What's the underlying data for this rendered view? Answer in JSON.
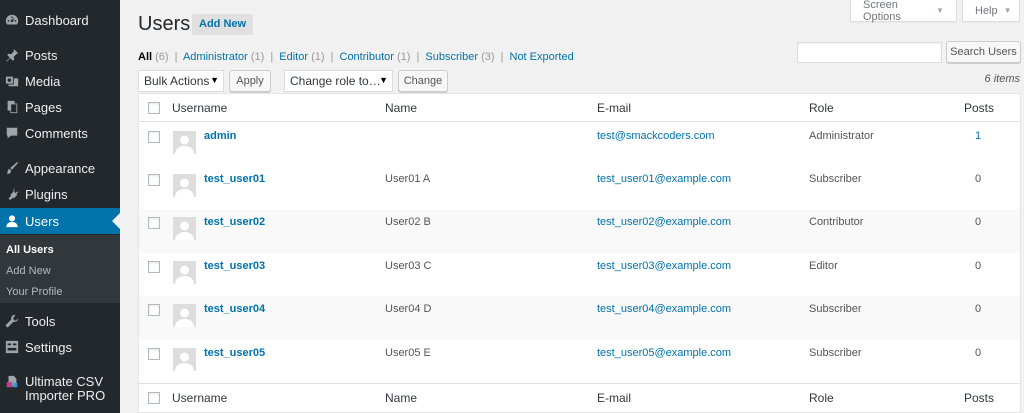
{
  "sidebar": {
    "items": [
      {
        "label": "Dashboard",
        "icon": "dashboard-icon"
      },
      {
        "label": "Posts",
        "icon": "pin-icon"
      },
      {
        "label": "Media",
        "icon": "media-icon"
      },
      {
        "label": "Pages",
        "icon": "pages-icon"
      },
      {
        "label": "Comments",
        "icon": "comment-icon"
      },
      {
        "label": "Appearance",
        "icon": "brush-icon"
      },
      {
        "label": "Plugins",
        "icon": "plug-icon"
      },
      {
        "label": "Users",
        "icon": "user-icon",
        "active": true
      },
      {
        "label": "Tools",
        "icon": "wrench-icon"
      },
      {
        "label": "Settings",
        "icon": "settings-icon"
      },
      {
        "label": "Ultimate CSV Importer PRO",
        "icon": "csv-importer-icon"
      }
    ],
    "users_submenu": [
      "All Users",
      "Add New",
      "Your Profile"
    ]
  },
  "header": {
    "title": "Users",
    "add_new": "Add New",
    "screen_options": "Screen Options",
    "help": "Help"
  },
  "filters": {
    "all": "All",
    "all_count": "(6)",
    "administrator": "Administrator",
    "administrator_count": "(1)",
    "editor": "Editor",
    "editor_count": "(1)",
    "contributor": "Contributor",
    "contributor_count": "(1)",
    "subscriber": "Subscriber",
    "subscriber_count": "(3)",
    "not_exported": "Not Exported",
    "separator": "|"
  },
  "search": {
    "value": "",
    "button": "Search Users"
  },
  "toolbar": {
    "bulk_actions": "Bulk Actions",
    "apply": "Apply",
    "change_role": "Change role to…",
    "change": "Change",
    "items_count": "6 items"
  },
  "table": {
    "columns": [
      "Username",
      "Name",
      "E-mail",
      "Role",
      "Posts"
    ],
    "rows": [
      {
        "username": "admin",
        "name": "",
        "email": "test@smackcoders.com",
        "role": "Administrator",
        "posts": "1"
      },
      {
        "username": "test_user01",
        "name": "User01 A",
        "email": "test_user01@example.com",
        "role": "Subscriber",
        "posts": "0"
      },
      {
        "username": "test_user02",
        "name": "User02 B",
        "email": "test_user02@example.com",
        "role": "Contributor",
        "posts": "0"
      },
      {
        "username": "test_user03",
        "name": "User03 C",
        "email": "test_user03@example.com",
        "role": "Editor",
        "posts": "0"
      },
      {
        "username": "test_user04",
        "name": "User04 D",
        "email": "test_user04@example.com",
        "role": "Subscriber",
        "posts": "0"
      },
      {
        "username": "test_user05",
        "name": "User05 E",
        "email": "test_user05@example.com",
        "role": "Subscriber",
        "posts": "0"
      }
    ]
  },
  "colors": {
    "sidebar_bg": "#23282d",
    "active_menu": "#0073aa",
    "link": "#0073aa",
    "page_bg": "#f1f1f1"
  }
}
